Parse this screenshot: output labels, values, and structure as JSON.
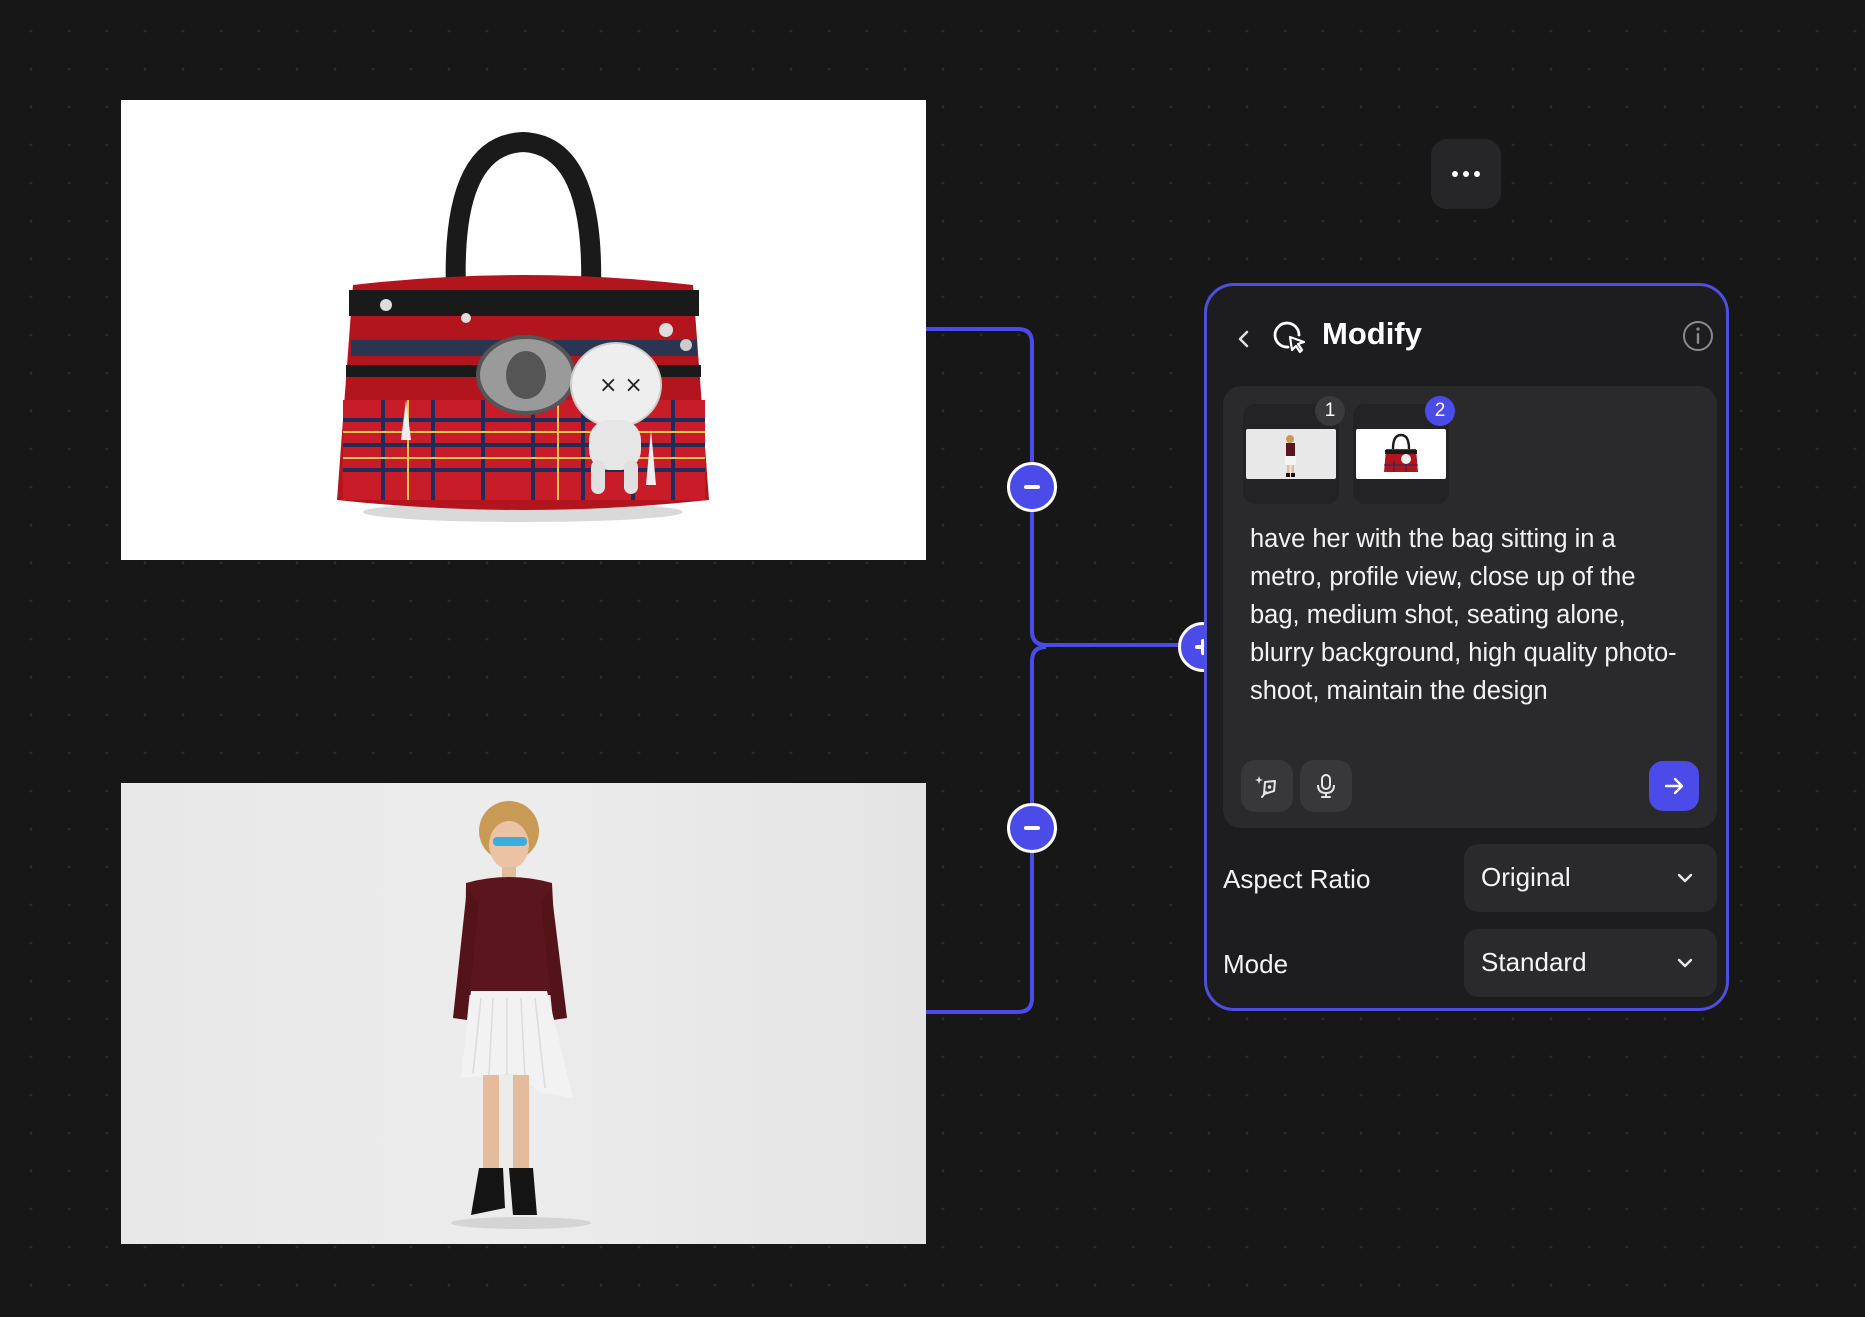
{
  "canvas": {
    "more_button_icon": "ellipsis-icon",
    "connector_color": "#4b4bea"
  },
  "images": {
    "bag": {
      "description_icon": "handbag-image"
    },
    "model": {
      "description_icon": "model-image"
    }
  },
  "panel": {
    "title": "Modify",
    "back_icon": "chevron-left-icon",
    "title_icon": "modify-cursor-icon",
    "info_icon": "info-icon",
    "accent_color": "#4b4bea",
    "references": [
      {
        "badge": "1",
        "kind": "model"
      },
      {
        "badge": "2",
        "kind": "bag"
      }
    ],
    "prompt": "have her with the bag sitting in a metro, profile view, close up of the bag, medium shot, seating alone, blurry background, high quality photo-shoot, maintain the design",
    "tools": [
      "enhance-prompt-icon",
      "microphone-icon"
    ],
    "send_icon": "arrow-right-icon"
  },
  "settings": {
    "aspect_ratio": {
      "label": "Aspect Ratio",
      "value": "Original"
    },
    "mode": {
      "label": "Mode",
      "value": "Standard"
    }
  }
}
